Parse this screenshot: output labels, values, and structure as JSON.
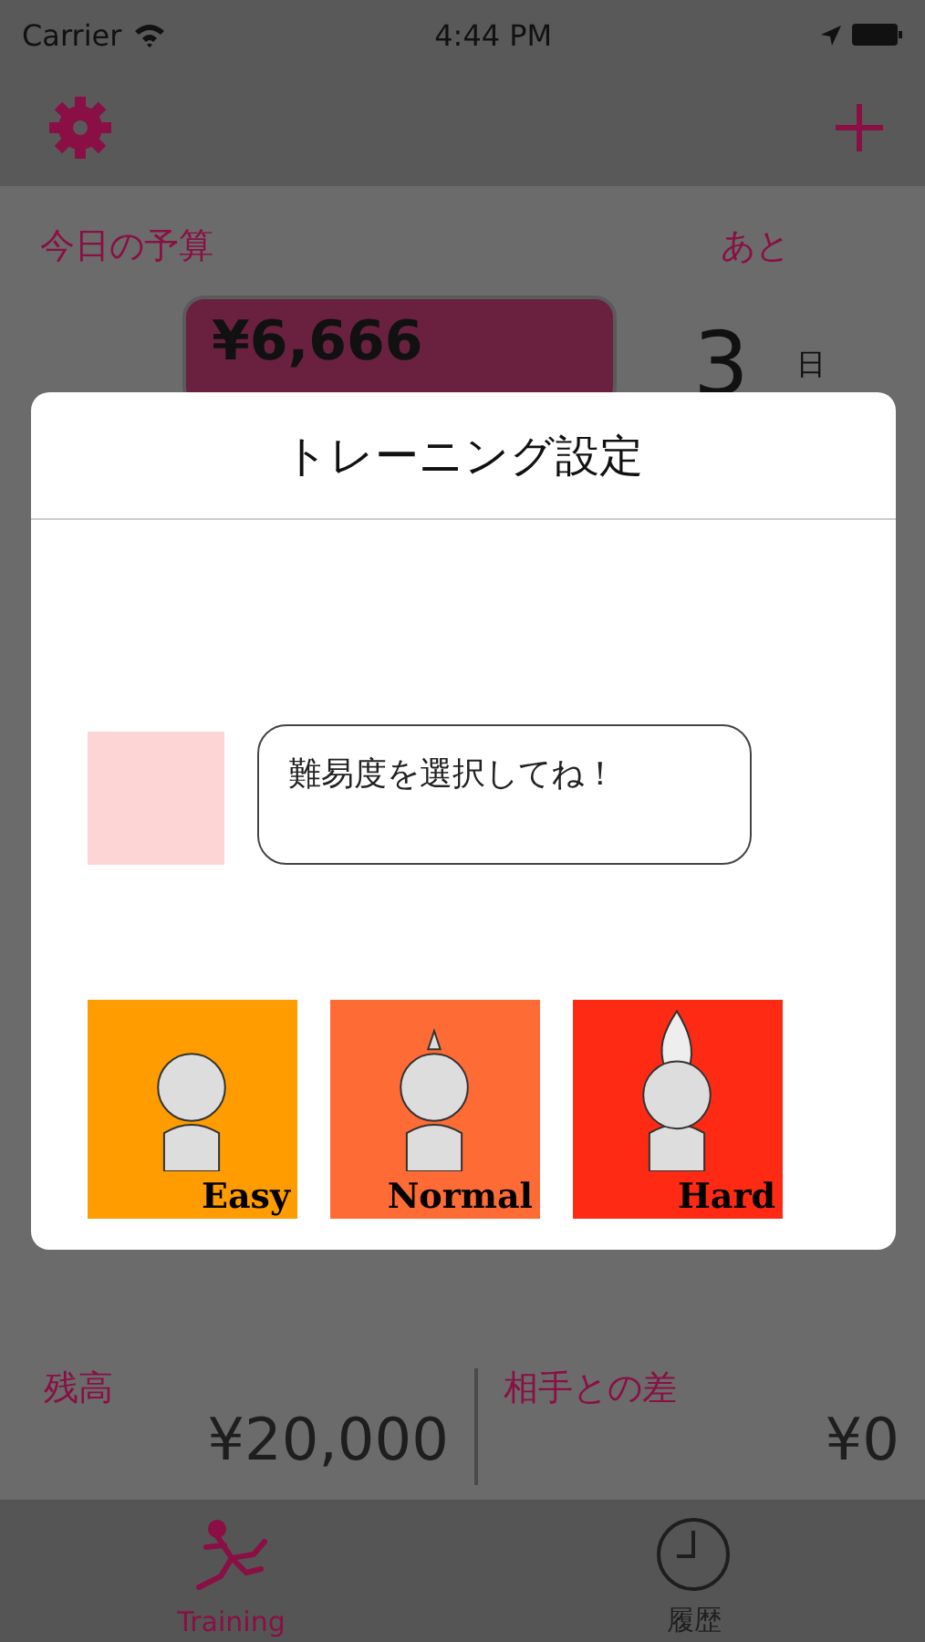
{
  "status_bar": {
    "carrier": "Carrier",
    "time": "4:44 PM"
  },
  "budget": {
    "label": "今日の予算",
    "amount": "¥6,666"
  },
  "remaining": {
    "label": "あと",
    "days": "3",
    "unit": "日"
  },
  "dialog": {
    "title": "トレーニング設定",
    "message": "難易度を選択してね！",
    "difficulties": [
      {
        "label": "Easy",
        "color": "#ff9c00",
        "kind": "plain"
      },
      {
        "label": "Normal",
        "color": "#ff6b35",
        "kind": "tuft"
      },
      {
        "label": "Hard",
        "color": "#ff2a14",
        "kind": "flame"
      }
    ]
  },
  "balance": {
    "label": "残高",
    "value": "¥20,000"
  },
  "difference": {
    "label": "相手との差",
    "value": "¥0"
  },
  "tabs": [
    {
      "label": "Training",
      "selected": true,
      "kind": "runner"
    },
    {
      "label": "履歴",
      "selected": false,
      "kind": "clock"
    }
  ]
}
